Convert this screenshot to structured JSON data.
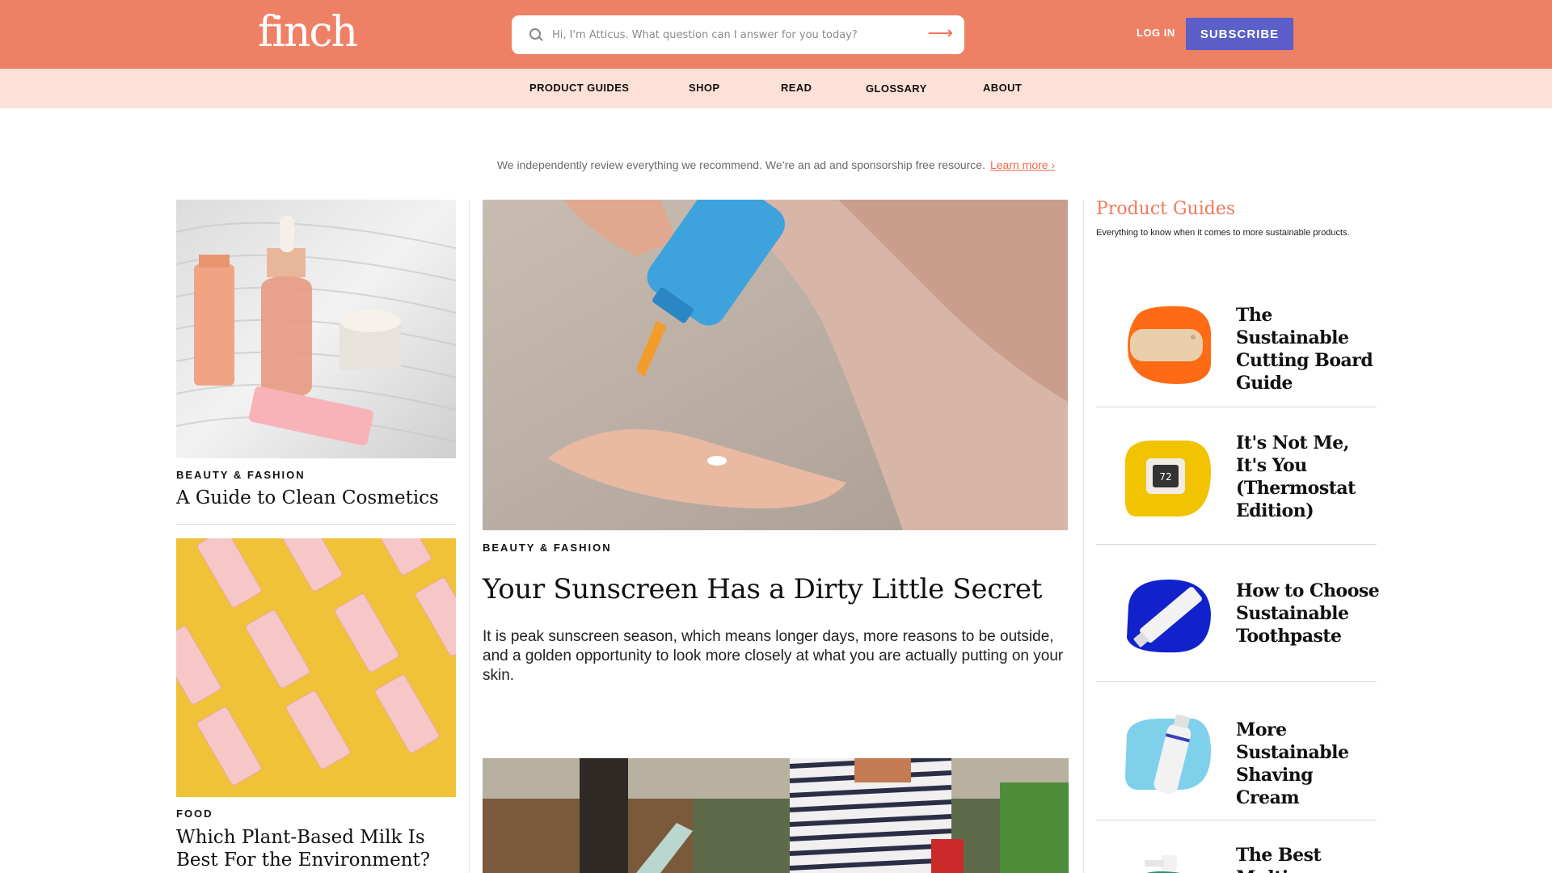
{
  "header": {
    "logo": "finch",
    "search_placeholder": "Hi, I'm Atticus. What question can I answer for you today?",
    "search_submit": "⟶",
    "login": "LOG IN",
    "subscribe": "SUBSCRIBE"
  },
  "nav": [
    "PRODUCT GUIDES",
    "SHOP",
    "READ",
    "GLOSSARY",
    "ABOUT"
  ],
  "notice": {
    "text": "We independently review everything we recommend. We’re an ad and sponsorship free resource.",
    "link": "Learn more ›"
  },
  "left_articles": [
    {
      "category": "BEAUTY & FASHION",
      "title": "A Guide to Clean Cosmetics"
    },
    {
      "category": "FOOD",
      "title": "Which Plant-Based Milk Is Best For the Environment?"
    }
  ],
  "feature": {
    "category": "BEAUTY & FASHION",
    "title": "Your Sunscreen Has a Dirty Little Secret",
    "excerpt": "It is peak sunscreen season, which means longer days, more reasons to be outside, and a golden opportunity to look more closely at what you are actually putting on your skin."
  },
  "product_guides": {
    "title": "Product Guides",
    "subtitle": "Everything to know when it comes to more sustainable products.",
    "items": [
      {
        "title": "The Sustainable Cutting Board Guide",
        "icon": "cutting-board-icon",
        "color": "#ff6a14"
      },
      {
        "title": "It's Not Me, It's You (Thermostat Edition)",
        "icon": "thermostat-icon",
        "color": "#f2c300",
        "display": "72"
      },
      {
        "title": "How to Choose Sustainable Toothpaste",
        "icon": "toothpaste-icon",
        "color": "#1122cc"
      },
      {
        "title": "More Sustainable Shaving Cream",
        "icon": "shaving-cream-icon",
        "color": "#7fd0ea"
      },
      {
        "title": "The Best Multi-",
        "icon": "spray-bottle-icon",
        "color": "#1a9a60"
      }
    ]
  }
}
